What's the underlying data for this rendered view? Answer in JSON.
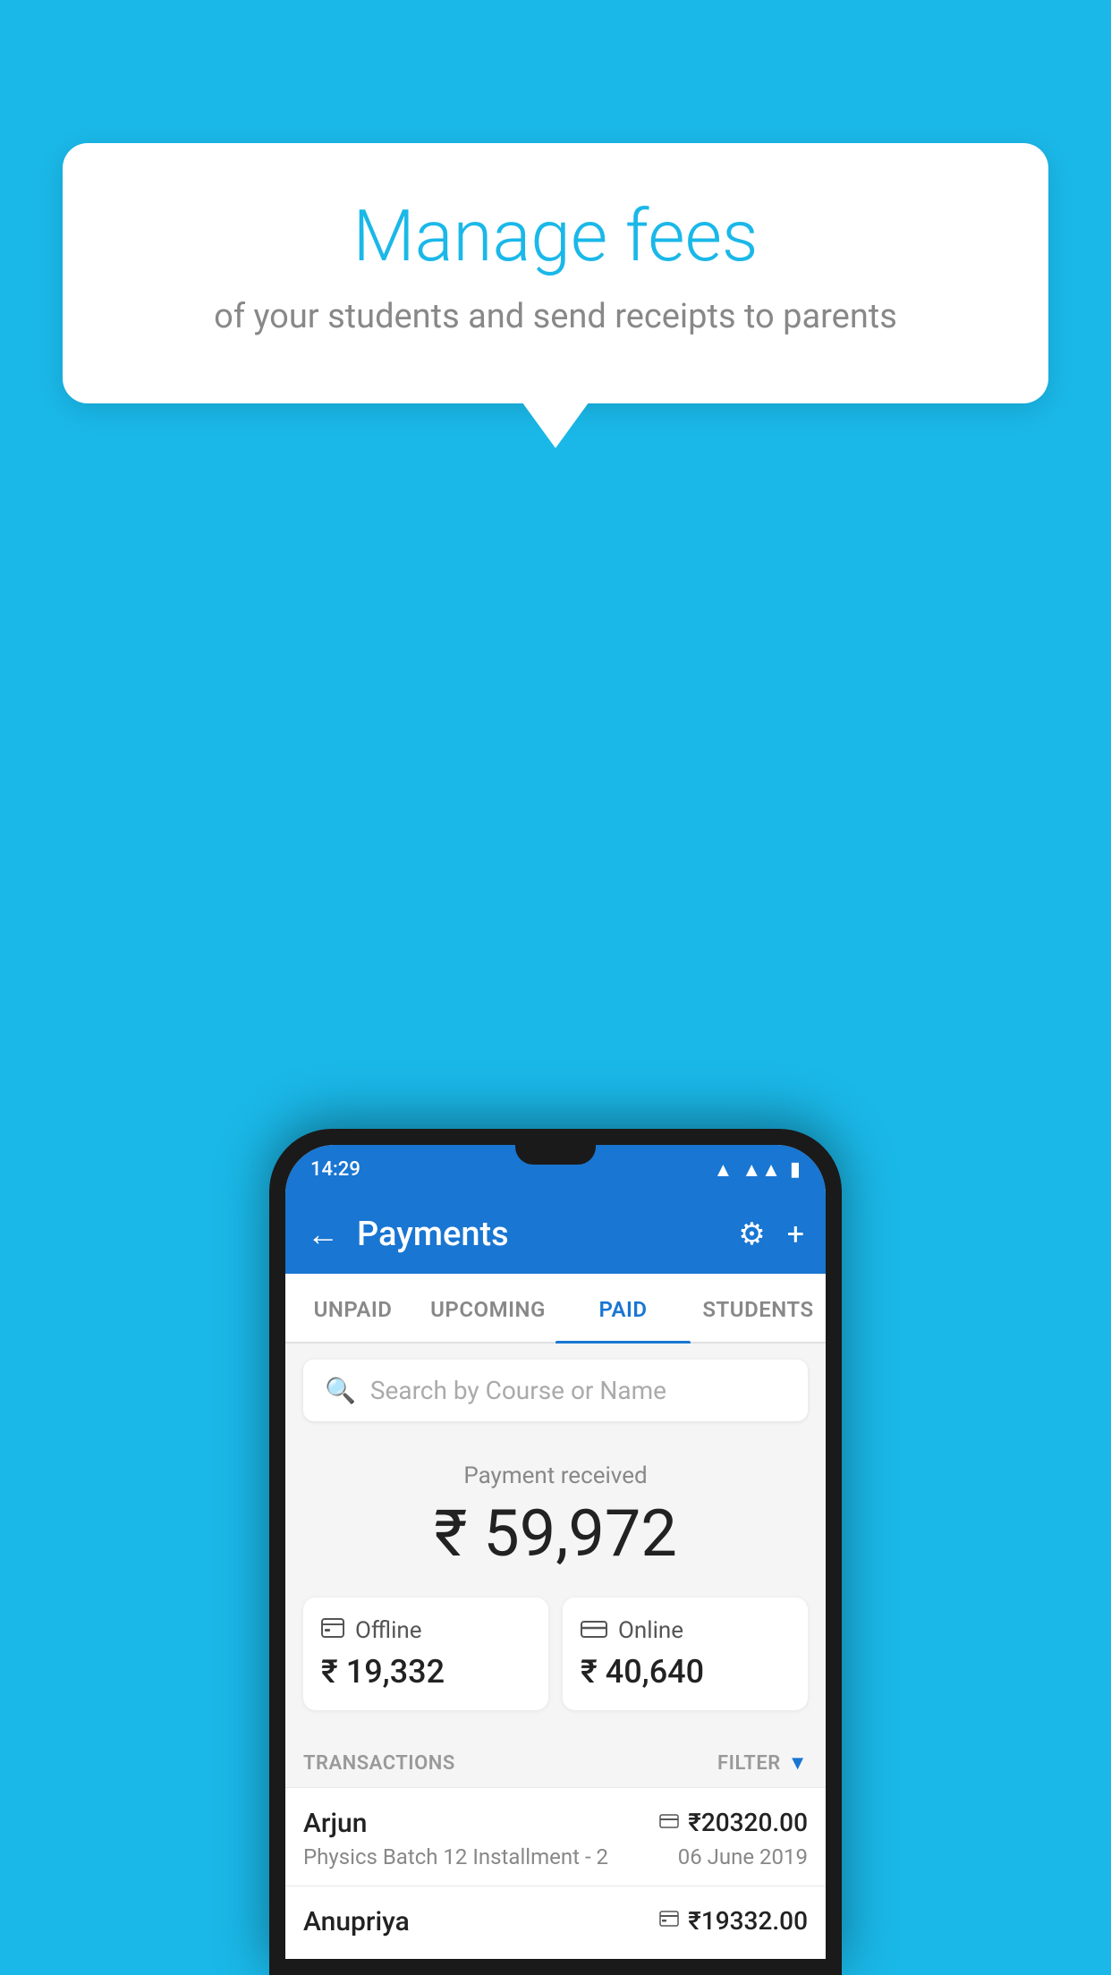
{
  "background_color": "#1ab8e8",
  "tooltip": {
    "title": "Manage fees",
    "subtitle": "of your students and send receipts to parents"
  },
  "phone": {
    "status_bar": {
      "time": "14:29",
      "wifi_icon": "wifi",
      "signal_icon": "signal",
      "battery_icon": "battery"
    },
    "app_bar": {
      "title": "Payments",
      "back_icon": "←",
      "settings_icon": "⚙",
      "add_icon": "+"
    },
    "tabs": [
      {
        "label": "UNPAID",
        "active": false
      },
      {
        "label": "UPCOMING",
        "active": false
      },
      {
        "label": "PAID",
        "active": true
      },
      {
        "label": "STUDENTS",
        "active": false
      }
    ],
    "search": {
      "placeholder": "Search by Course or Name"
    },
    "payment_received": {
      "label": "Payment received",
      "amount": "₹ 59,972"
    },
    "payment_cards": [
      {
        "icon": "💳",
        "label": "Offline",
        "amount": "₹ 19,332"
      },
      {
        "icon": "💳",
        "label": "Online",
        "amount": "₹ 40,640"
      }
    ],
    "transactions_section": {
      "label": "TRANSACTIONS",
      "filter_label": "FILTER"
    },
    "transactions": [
      {
        "name": "Arjun",
        "course": "Physics Batch 12 Installment - 2",
        "amount": "₹20320.00",
        "date": "06 June 2019",
        "payment_type": "online"
      },
      {
        "name": "Anupriya",
        "course": "",
        "amount": "₹19332.00",
        "date": "",
        "payment_type": "offline"
      }
    ]
  },
  "accent_color": "#1976d2",
  "light_blue": "#1ab8e8"
}
